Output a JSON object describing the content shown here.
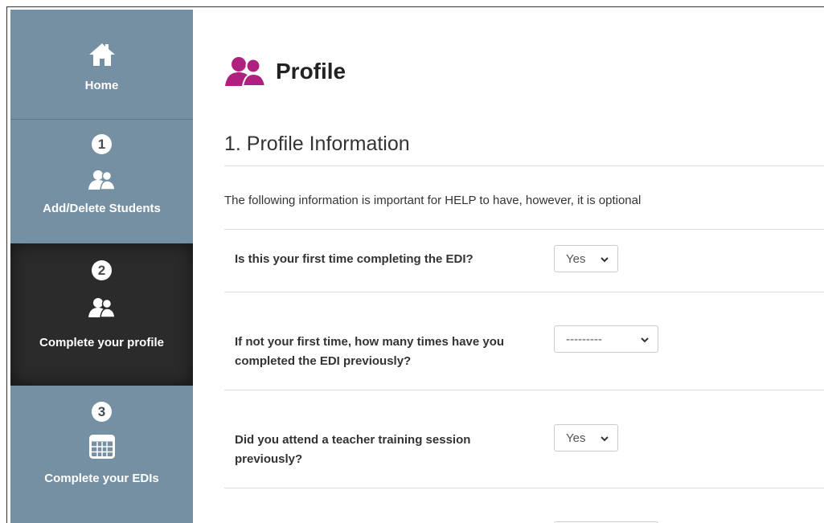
{
  "sidebar": {
    "home": {
      "label": "Home",
      "icon": "home-icon"
    },
    "items": [
      {
        "number": "1",
        "label": "Add/Delete Students",
        "icon": "users-icon"
      },
      {
        "number": "2",
        "label": "Complete your profile",
        "icon": "users-icon",
        "active": true
      },
      {
        "number": "3",
        "label": "Complete your EDIs",
        "icon": "table-icon"
      }
    ]
  },
  "page": {
    "title": "Profile",
    "title_icon": "users-icon",
    "section_title": "1. Profile Information",
    "intro": "The following information is important for HELP to have, however, it is optional"
  },
  "questions": [
    {
      "text": "Is this your first time completing the EDI?",
      "value": "Yes"
    },
    {
      "text": "If not your first time, how many times have you completed the EDI previously?",
      "value": "---------"
    },
    {
      "text": "Did you attend a teacher training session previously?",
      "value": "Yes"
    }
  ],
  "colors": {
    "sidebar_bg": "#7590a3",
    "sidebar_active_bg": "#2b2b2b",
    "accent_magenta": "#b0207f"
  }
}
